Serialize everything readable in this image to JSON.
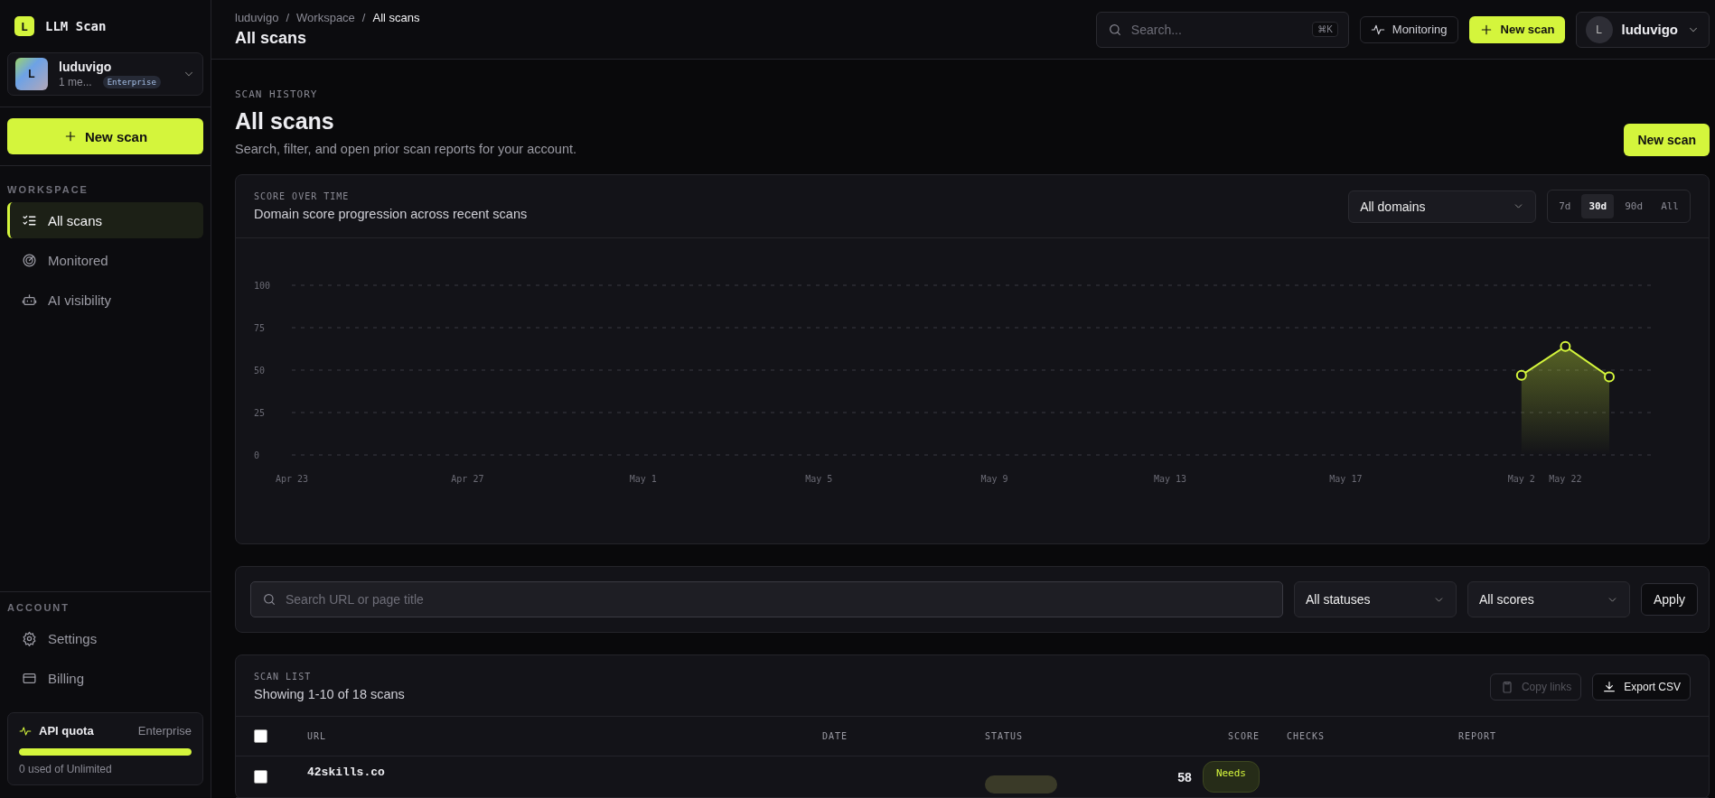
{
  "brand": {
    "logo_letter": "L",
    "name": "LLM Scan"
  },
  "account": {
    "avatar_letter": "L",
    "name": "luduvigo",
    "members": "1 me...",
    "plan": "Enterprise"
  },
  "sidebar": {
    "new_scan": "New scan",
    "sections": [
      {
        "title": "WORKSPACE",
        "items": [
          {
            "label": "All scans",
            "selected": true
          },
          {
            "label": "Monitored",
            "selected": false
          },
          {
            "label": "AI visibility",
            "selected": false
          }
        ]
      },
      {
        "title": "ACCOUNT",
        "items": [
          {
            "label": "Settings",
            "selected": false
          },
          {
            "label": "Billing",
            "selected": false
          }
        ]
      }
    ],
    "quota": {
      "title": "API quota",
      "plan": "Enterprise",
      "level": 1,
      "text": "0 used of Unlimited"
    }
  },
  "header": {
    "breadcrumb": [
      {
        "label": "luduvigo",
        "current": false
      },
      {
        "separator": "/"
      },
      {
        "label": "Workspace",
        "current": false
      },
      {
        "separator": "/"
      },
      {
        "label": "All scans",
        "current": true
      }
    ],
    "title": "All scans",
    "search": {
      "placeholder": "Search...",
      "shortcut": "⌘K"
    },
    "monitoring": "Monitoring",
    "new_scan": "New scan",
    "user": {
      "avatar_letter": "L",
      "name": "luduvigo"
    }
  },
  "page": {
    "eyebrow": "SCAN HISTORY",
    "title": "All scans",
    "subtitle": "Search, filter, and open prior scan reports for your account.",
    "new_scan": "New scan"
  },
  "chart_card": {
    "eyebrow": "SCORE OVER TIME",
    "subtitle": "Domain score progression across recent scans",
    "domain_select": "All domains",
    "ranges": [
      {
        "label": "7d",
        "selected": false
      },
      {
        "label": "30d",
        "selected": true
      },
      {
        "label": "90d",
        "selected": false
      },
      {
        "label": "All",
        "selected": false
      }
    ],
    "chart_data": {
      "type": "area",
      "categories": [
        "Apr 23",
        null,
        null,
        null,
        "Apr 27",
        null,
        null,
        null,
        "May 1",
        null,
        null,
        null,
        "May 5",
        null,
        null,
        null,
        "May 9",
        null,
        null,
        null,
        "May 13",
        null,
        null,
        null,
        "May 17",
        null,
        null,
        null,
        "May 2",
        "May 22",
        null
      ],
      "series": [
        {
          "color": "#d4f53c",
          "values": [
            null,
            null,
            null,
            null,
            null,
            null,
            null,
            null,
            null,
            null,
            null,
            null,
            null,
            null,
            null,
            null,
            null,
            null,
            null,
            null,
            null,
            null,
            null,
            null,
            null,
            null,
            null,
            null,
            47,
            64,
            46
          ]
        }
      ],
      "ylim": [
        0,
        100
      ],
      "yticks": [
        0,
        25,
        50,
        75,
        100
      ],
      "grid": true
    }
  },
  "filters": {
    "search": {
      "placeholder": "Search URL or page title"
    },
    "status_select": "All statuses",
    "score_select": "All scores",
    "apply": "Apply"
  },
  "scan_list": {
    "eyebrow": "SCAN LIST",
    "summary": "Showing 1-10 of 18 scans",
    "copy_links": {
      "label": "Copy links",
      "disabled": true
    },
    "export": "Export CSV",
    "columns": [
      "URL",
      "DATE",
      "STATUS",
      "SCORE",
      "CHECKS",
      "REPORT"
    ],
    "select_all": {
      "checked": false
    },
    "rows": [
      {
        "checked": false,
        "url": "42skills.co",
        "score": "58",
        "grade": "Needs"
      }
    ]
  }
}
